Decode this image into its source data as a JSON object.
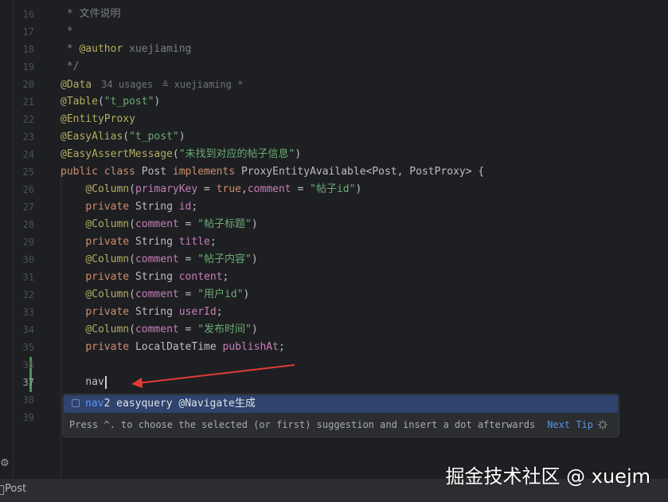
{
  "gutter": {
    "line_numbers": [
      "16",
      "17",
      "18",
      "19",
      "20",
      "21",
      "22",
      "23",
      "24",
      "25",
      "26",
      "27",
      "28",
      "29",
      "30",
      "31",
      "32",
      "33",
      "34",
      "35",
      "36",
      "37",
      "38",
      "39"
    ],
    "active_line": "37"
  },
  "code": {
    "l16_star": " * ",
    "l16_text": "文件说明",
    "l17": " *",
    "l18_star": " * ",
    "l18_tag": "@author",
    "l18_name": " xuejiaming",
    "l19": " */",
    "l20_ann": "@Data",
    "l20_usages": "34 usages",
    "l20_author": "xuejiaming *",
    "l21_ann": "@Table",
    "l21_str": "\"t_post\"",
    "l22_ann": "@EntityProxy",
    "l23_ann": "@EasyAlias",
    "l23_str": "\"t_post\"",
    "l24_ann": "@EasyAssertMessage",
    "l24_str": "\"未找到对应的帖子信息\"",
    "l25_kw": "public class ",
    "l25_name": "Post ",
    "l25_kw2": "implements ",
    "l25_rest": "ProxyEntityAvailable<Post, PostProxy> {",
    "col_ann": "@Column",
    "l26_param1": "primaryKey",
    "l26_eq": " = ",
    "l26_true": "true",
    "l26_comma": ",",
    "l26_param2": "comment",
    "l26_str": "\"帖子id\"",
    "private_kw": "private ",
    "l27_type": "String ",
    "l27_field": "id",
    "comment_param": "comment",
    "l28_str": "\"帖子标题\"",
    "l29_type": "String ",
    "l29_field": "title",
    "l30_str": "\"帖子内容\"",
    "l31_type": "String ",
    "l31_field": "content",
    "l32_str": "\"用户id\"",
    "l33_type": "String ",
    "l33_field": "userId",
    "l34_str": "\"发布时间\"",
    "l35_type": "LocalDateTime ",
    "l35_field": "publishAt",
    "l37_typed": "nav"
  },
  "popup": {
    "item_match": "nav",
    "item_rest": "2 easyquery @Navigate生成",
    "footer": "Press ^. to choose the selected (or first) suggestion and insert a dot afterwards",
    "next_tip": "Next Tip"
  },
  "statusbar": {
    "label": "Post"
  },
  "watermark": "掘金技术社区 @ xuejm",
  "colors": {
    "background": "#1e1f22",
    "keyword": "#cf8e6d",
    "annotation": "#b3ae60",
    "string": "#6aab73",
    "field": "#c77dba",
    "popup_selected": "#2e436e",
    "arrow": "#e53935"
  }
}
